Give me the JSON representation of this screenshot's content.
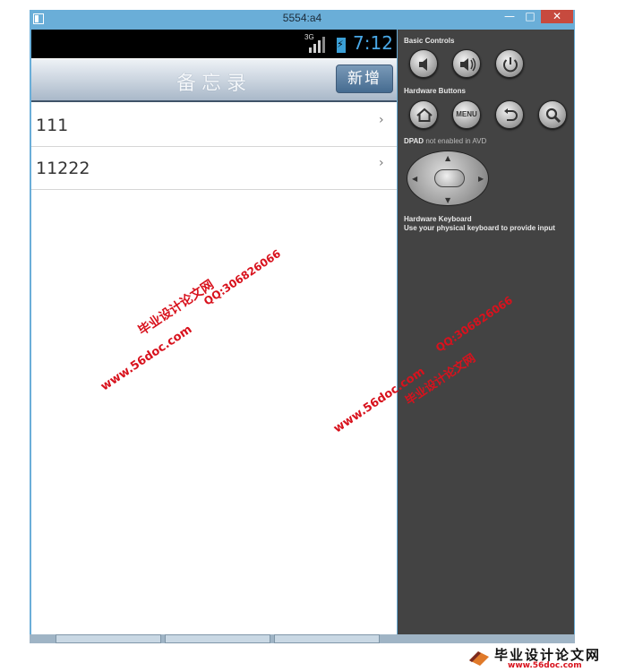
{
  "window": {
    "title": "5554:a4",
    "min_label": "—",
    "max_label": "□",
    "close_label": "✕"
  },
  "status_bar": {
    "network": "3G",
    "time": "7:12"
  },
  "action_bar": {
    "title": "备忘录",
    "add_label": "新增"
  },
  "memos": [
    {
      "title": "111",
      "chevron": "›"
    },
    {
      "title": "11222",
      "chevron": "›"
    }
  ],
  "controls": {
    "basic_label": "Basic Controls",
    "hardware_label": "Hardware Buttons",
    "menu_label": "MENU",
    "dpad_label": "DPAD",
    "dpad_note": "not enabled in AVD",
    "keyboard_title": "Hardware Keyboard",
    "keyboard_note": "Use your physical keyboard to provide input"
  },
  "watermarks": {
    "site_cn": "毕业设计论文网",
    "qq": "QQ:306826066",
    "url": "www.56doc.com"
  },
  "logo": {
    "text": "毕业设计论文网",
    "url": "www.56doc.com"
  },
  "colors": {
    "accent": "#49a8e6",
    "watermark": "#d8121d",
    "window_frame": "#6aaed8",
    "panel": "#434343"
  }
}
